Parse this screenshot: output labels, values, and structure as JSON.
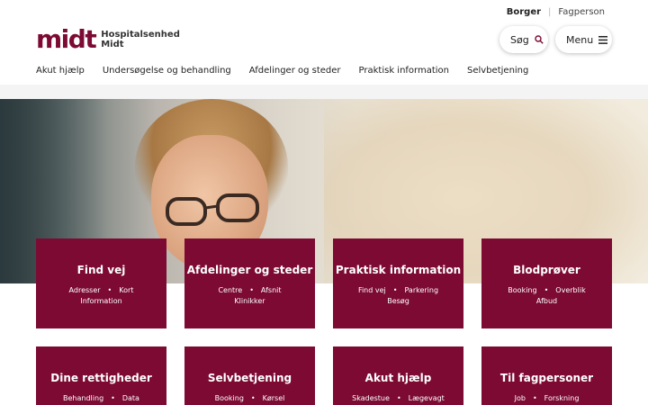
{
  "audience": {
    "active": "Borger",
    "inactive": "Fagperson"
  },
  "logo": {
    "mark": "midt",
    "line1": "Hospitalsenhed",
    "line2": "Midt"
  },
  "header": {
    "search_label": "Søg",
    "menu_label": "Menu"
  },
  "nav": [
    "Akut hjælp",
    "Undersøgelse og behandling",
    "Afdelinger og steder",
    "Praktisk information",
    "Selvbetjening"
  ],
  "tiles": [
    {
      "title": "Find vej",
      "links": [
        "Adresser",
        "Kort",
        "Information"
      ]
    },
    {
      "title": "Afdelinger og steder",
      "links": [
        "Centre",
        "Afsnit",
        "Klinikker"
      ]
    },
    {
      "title": "Praktisk information",
      "links": [
        "Find vej",
        "Parkering",
        "Besøg"
      ]
    },
    {
      "title": "Blodprøver",
      "links": [
        "Booking",
        "Overblik",
        "Afbud"
      ]
    },
    {
      "title": "Dine rettigheder",
      "links": [
        "Behandling",
        "Data"
      ]
    },
    {
      "title": "Selvbetjening",
      "links": [
        "Booking",
        "Kørsel"
      ]
    },
    {
      "title": "Akut hjælp",
      "links": [
        "Skadestue",
        "Lægevagt"
      ]
    },
    {
      "title": "Til fagpersoner",
      "links": [
        "Job",
        "Forskning"
      ]
    }
  ],
  "colors": {
    "brand": "#7c0a32"
  }
}
